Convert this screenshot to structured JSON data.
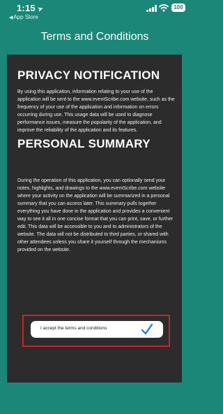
{
  "status_bar": {
    "time": "1:15",
    "back_app": "App Store",
    "battery": "100"
  },
  "nav": {
    "title": "Terms and Conditions"
  },
  "content": {
    "privacy_heading": "PRIVACY NOTIFICATION",
    "privacy_text": "By using this application, information relating to your use of the application will be sent to the www.eventScribe.com website, such as the frequency of your use of the application and information on errors occurring during use. This usage data will be used to diagnose performance issues, measure the popularity of the application, and improve the reliability of the application and its features.",
    "summary_heading": "PERSONAL SUMMARY",
    "summary_text": "During the operation of this application, you can optionally send your notes, highlights, and drawings to the www.eventScribe.com website where your activity on the application will be summarized in a personal summary that you can access later. This summary pulls together everything you have done in the application and provides a convenient way to see it all in one concise format that you can print, save, or further edit. This data will be accessible to you and to administrators of the website. The data will not be distributed to third parties, or shared with other attendees unless you share it yourself through the mechanisms provided on the website."
  },
  "accept": {
    "label": "I accept the terms and conditions",
    "checked": true,
    "check_color": "#1a73e8",
    "highlight_color": "#d0202a"
  },
  "colors": {
    "brand": "#1b8779",
    "panel": "#2c2c2c"
  }
}
